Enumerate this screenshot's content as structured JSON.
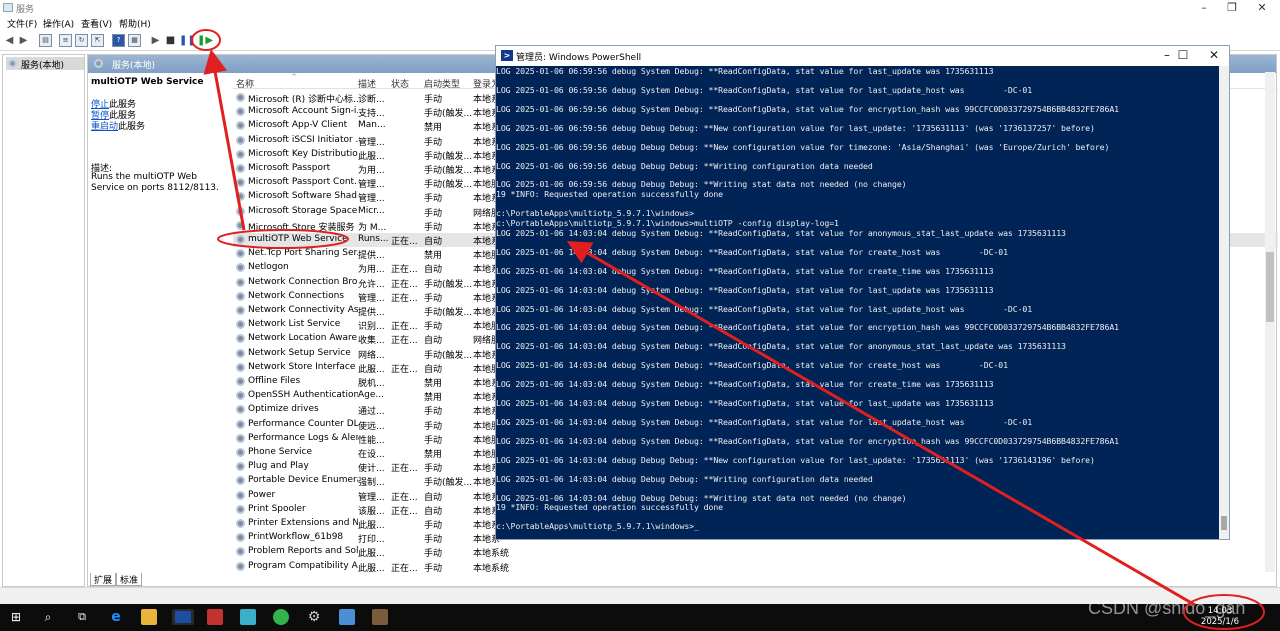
{
  "services_window": {
    "title": "服务",
    "menu": [
      "文件(F)",
      "操作(A)",
      "查看(V)",
      "帮助(H)"
    ],
    "tree_root": "服务(本地)",
    "content_header": "服务(本地)",
    "selected_service_name": "multiOTP Web Service",
    "actions": [
      {
        "link": "停止",
        "suffix": "此服务"
      },
      {
        "link": "暂停",
        "suffix": "此服务"
      },
      {
        "link": "重启动",
        "suffix": "此服务"
      }
    ],
    "description_label": "描述:",
    "description_text": "Runs the multiOTP Web Service on ports 8112/8113.",
    "columns": [
      "名称",
      "描述",
      "状态",
      "启动类型",
      "登录为"
    ],
    "rows": [
      {
        "name": "Microsoft (R) 诊断中心标...",
        "desc": "诊断...",
        "status": "",
        "startup": "手动",
        "logon": "本地系"
      },
      {
        "name": "Microsoft Account Sign-i...",
        "desc": "支持...",
        "status": "",
        "startup": "手动(触发...",
        "logon": "本地系"
      },
      {
        "name": "Microsoft App-V Client",
        "desc": "Man...",
        "status": "",
        "startup": "禁用",
        "logon": "本地系"
      },
      {
        "name": "Microsoft iSCSI Initiator ...",
        "desc": "管理...",
        "status": "",
        "startup": "手动",
        "logon": "本地系"
      },
      {
        "name": "Microsoft Key Distributio...",
        "desc": "此服...",
        "status": "",
        "startup": "手动(触发...",
        "logon": "本地系"
      },
      {
        "name": "Microsoft Passport",
        "desc": "为用...",
        "status": "",
        "startup": "手动(触发...",
        "logon": "本地系"
      },
      {
        "name": "Microsoft Passport Cont...",
        "desc": "管理...",
        "status": "",
        "startup": "手动(触发...",
        "logon": "本地服"
      },
      {
        "name": "Microsoft Software Shad...",
        "desc": "管理...",
        "status": "",
        "startup": "手动",
        "logon": "本地系"
      },
      {
        "name": "Microsoft Storage Space...",
        "desc": "Micr...",
        "status": "",
        "startup": "手动",
        "logon": "网络服"
      },
      {
        "name": "Microsoft Store 安装服务",
        "desc": "为 M...",
        "status": "",
        "startup": "手动",
        "logon": "本地系"
      },
      {
        "name": "multiOTP Web Service",
        "desc": "Runs...",
        "status": "正在...",
        "startup": "自动",
        "logon": "本地系"
      },
      {
        "name": "Net.Tcp Port Sharing Ser...",
        "desc": "提供...",
        "status": "",
        "startup": "禁用",
        "logon": "本地服"
      },
      {
        "name": "Netlogon",
        "desc": "为用...",
        "status": "正在...",
        "startup": "自动",
        "logon": "本地系"
      },
      {
        "name": "Network Connection Bro...",
        "desc": "允许...",
        "status": "正在...",
        "startup": "手动(触发...",
        "logon": "本地系"
      },
      {
        "name": "Network Connections",
        "desc": "管理...",
        "status": "正在...",
        "startup": "手动",
        "logon": "本地系"
      },
      {
        "name": "Network Connectivity Ass...",
        "desc": "提供...",
        "status": "",
        "startup": "手动(触发...",
        "logon": "本地系"
      },
      {
        "name": "Network List Service",
        "desc": "识别...",
        "status": "正在...",
        "startup": "手动",
        "logon": "本地服"
      },
      {
        "name": "Network Location Aware...",
        "desc": "收集...",
        "status": "正在...",
        "startup": "自动",
        "logon": "网络服"
      },
      {
        "name": "Network Setup Service",
        "desc": "网络...",
        "status": "",
        "startup": "手动(触发...",
        "logon": "本地系"
      },
      {
        "name": "Network Store Interface ...",
        "desc": "此服...",
        "status": "正在...",
        "startup": "自动",
        "logon": "本地服"
      },
      {
        "name": "Offline Files",
        "desc": "脱机...",
        "status": "",
        "startup": "禁用",
        "logon": "本地系"
      },
      {
        "name": "OpenSSH Authentication ...",
        "desc": "Age...",
        "status": "",
        "startup": "禁用",
        "logon": "本地系"
      },
      {
        "name": "Optimize drives",
        "desc": "通过...",
        "status": "",
        "startup": "手动",
        "logon": "本地系"
      },
      {
        "name": "Performance Counter DL...",
        "desc": "使远...",
        "status": "",
        "startup": "手动",
        "logon": "本地服"
      },
      {
        "name": "Performance Logs & Aler...",
        "desc": "性能...",
        "status": "",
        "startup": "手动",
        "logon": "本地服"
      },
      {
        "name": "Phone Service",
        "desc": "在设...",
        "status": "",
        "startup": "禁用",
        "logon": "本地服"
      },
      {
        "name": "Plug and Play",
        "desc": "使计...",
        "status": "正在...",
        "startup": "手动",
        "logon": "本地系"
      },
      {
        "name": "Portable Device Enumera...",
        "desc": "强制...",
        "status": "",
        "startup": "手动(触发...",
        "logon": "本地系"
      },
      {
        "name": "Power",
        "desc": "管理...",
        "status": "正在...",
        "startup": "自动",
        "logon": "本地系"
      },
      {
        "name": "Print Spooler",
        "desc": "该服...",
        "status": "正在...",
        "startup": "自动",
        "logon": "本地系"
      },
      {
        "name": "Printer Extensions and N...",
        "desc": "此服...",
        "status": "",
        "startup": "手动",
        "logon": "本地系"
      },
      {
        "name": "PrintWorkflow_61b98",
        "desc": "打印...",
        "status": "",
        "startup": "手动",
        "logon": "本地系"
      },
      {
        "name": "Problem Reports and Sol...",
        "desc": "此服...",
        "status": "",
        "startup": "手动",
        "logon": "本地系统"
      },
      {
        "name": "Program Compatibility A...",
        "desc": "此服...",
        "status": "正在...",
        "startup": "手动",
        "logon": "本地系统"
      }
    ],
    "bottom_tabs": [
      "扩展",
      "标准"
    ]
  },
  "powershell": {
    "title": "管理员: Windows PowerShell",
    "lines": [
      "LOG 2025-01-06 06:59:56 debug System Debug: **ReadConfigData, stat value for last_update was 1735631113",
      "LOG 2025-01-06 06:59:56 debug System Debug: **ReadConfigData, stat value for last_update_host was        -DC-01",
      "LOG 2025-01-06 06:59:56 debug System Debug: **ReadConfigData, stat value for encryption_hash was 99CCFC0D033729754B6BB4832FE786A1",
      "LOG 2025-01-06 06:59:56 debug Debug Debug: **New configuration value for last_update: '1735631113' (was '1736137257' before)",
      "LOG 2025-01-06 06:59:56 debug Debug Debug: **New configuration value for timezone: 'Asia/Shanghai' (was 'Europe/Zurich' before)",
      "LOG 2025-01-06 06:59:56 debug Debug Debug: **Writing configuration data needed",
      "LOG 2025-01-06 06:59:56 debug Debug Debug: **Writing stat data not needed (no change)",
      "19 *INFO: Requested operation successfully done",
      "c:\\PortableApps\\multiotp_5.9.7.1\\windows>",
      "c:\\PortableApps\\multiotp_5.9.7.1\\windows>multiOTP -config display-log=1",
      "LOG 2025-01-06 14:03:04 debug System Debug: **ReadConfigData, stat value for anonymous_stat_last_update was 1735631113",
      "LOG 2025-01-06 14:03:04 debug System Debug: **ReadConfigData, stat value for create_host was        -DC-01",
      "LOG 2025-01-06 14:03:04 debug System Debug: **ReadConfigData, stat value for create_time was 1735631113",
      "LOG 2025-01-06 14:03:04 debug System Debug: **ReadConfigData, stat value for last_update was 1735631113",
      "LOG 2025-01-06 14:03:04 debug System Debug: **ReadConfigData, stat value for last_update_host was        -DC-01",
      "LOG 2025-01-06 14:03:04 debug System Debug: **ReadConfigData, stat value for encryption_hash was 99CCFC0D033729754B6BB4832FE786A1",
      "LOG 2025-01-06 14:03:04 debug System Debug: **ReadConfigData, stat value for anonymous_stat_last_update was 1735631113",
      "LOG 2025-01-06 14:03:04 debug System Debug: **ReadConfigData, stat value for create_host was        -DC-01",
      "LOG 2025-01-06 14:03:04 debug System Debug: **ReadConfigData, stat value for create_time was 1735631113",
      "LOG 2025-01-06 14:03:04 debug System Debug: **ReadConfigData, stat value for last_update was 1735631113",
      "LOG 2025-01-06 14:03:04 debug System Debug: **ReadConfigData, stat value for last_update_host was        -DC-01",
      "LOG 2025-01-06 14:03:04 debug System Debug: **ReadConfigData, stat value for encryption_hash was 99CCFC0D033729754B6BB4832FE786A1",
      "LOG 2025-01-06 14:03:04 debug Debug Debug: **New configuration value for last_update: '1735631113' (was '1736143196' before)",
      "LOG 2025-01-06 14:03:04 debug Debug Debug: **Writing configuration data needed",
      "LOG 2025-01-06 14:03:04 debug Debug Debug: **Writing stat data not needed (no change)",
      "19 *INFO: Requested operation successfully done",
      "c:\\PortableApps\\multiotp_5.9.7.1\\windows>_"
    ]
  },
  "taskbar": {
    "clock_time": "14:03",
    "clock_date": "2025/1/6",
    "watermark": "CSDN @shido_gan"
  },
  "colors": {
    "console_bg": "#012456",
    "annotation": "#e02020",
    "header_blue": "#8aa7c8"
  }
}
